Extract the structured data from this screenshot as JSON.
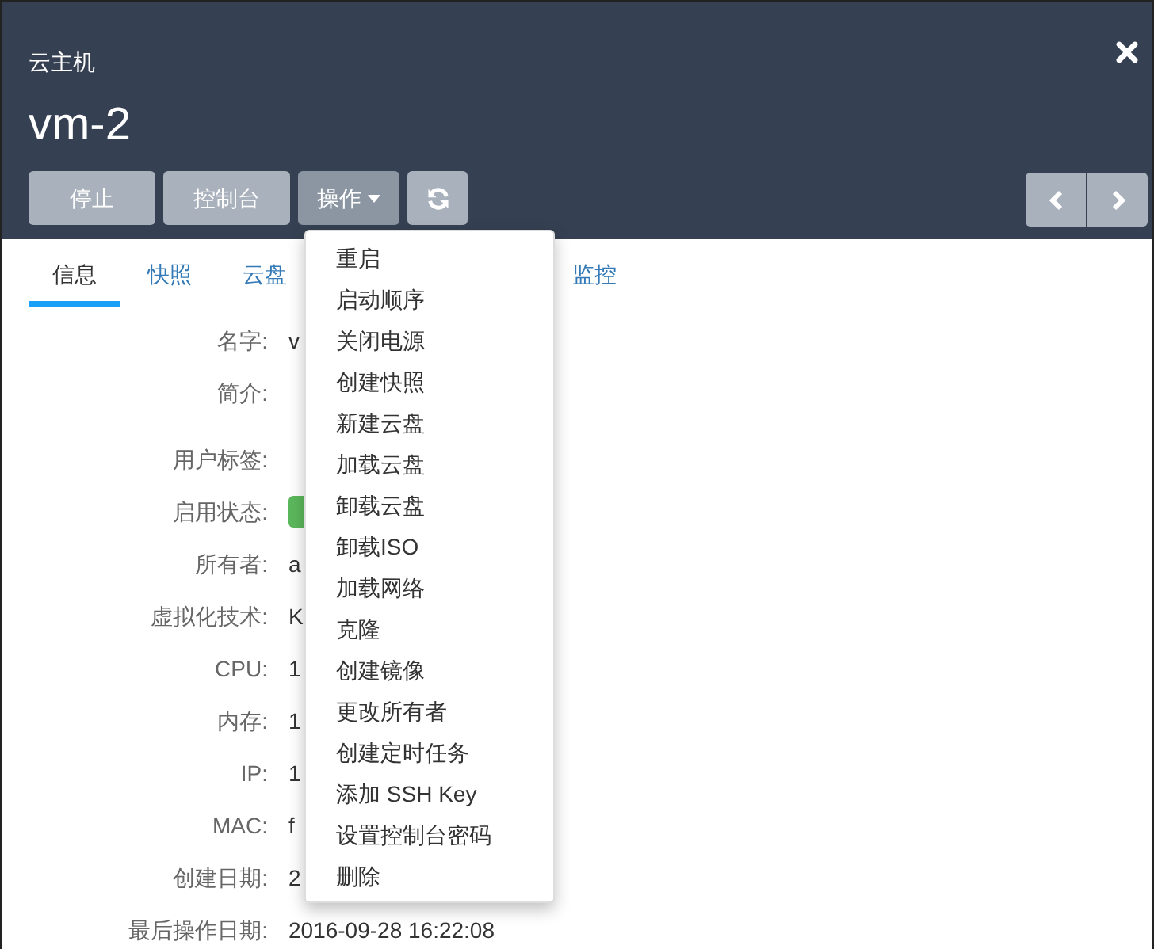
{
  "header": {
    "subtitle": "云主机",
    "title": "vm-2"
  },
  "toolbar": {
    "buttons": [
      {
        "label": "停止",
        "kind": "plain"
      },
      {
        "label": "控制台",
        "kind": "plain"
      },
      {
        "label": "操作",
        "kind": "dropdown",
        "expanded": true
      },
      {
        "kind": "refresh"
      }
    ]
  },
  "tabs": [
    {
      "label": "信息",
      "selected": true
    },
    {
      "label": "快照",
      "selected": false
    },
    {
      "label": "云盘",
      "selected": false
    },
    {
      "label": "监控",
      "selected": false
    }
  ],
  "dropdown": {
    "items": [
      "重启",
      "启动顺序",
      "关闭电源",
      "创建快照",
      "新建云盘",
      "加载云盘",
      "卸载云盘",
      "卸载ISO",
      "加载网络",
      "克隆",
      "创建镜像",
      "更改所有者",
      "创建定时任务",
      "添加 SSH Key",
      "设置控制台密码",
      "删除"
    ]
  },
  "details": [
    {
      "label": "名字:",
      "value": "v",
      "kind": "text"
    },
    {
      "label": "简介:",
      "kind": "tall"
    },
    {
      "label": "用户标签:",
      "kind": "text"
    },
    {
      "label": "启用状态:",
      "kind": "badge",
      "color": "#5cb85c"
    },
    {
      "label": "所有者:",
      "value": "a",
      "kind": "text"
    },
    {
      "label": "虚拟化技术:",
      "value": "K",
      "kind": "text"
    },
    {
      "label": "CPU:",
      "value": "1",
      "kind": "text"
    },
    {
      "label": "内存:",
      "value": "1",
      "kind": "text"
    },
    {
      "label": "IP:",
      "value": "1",
      "kind": "text"
    },
    {
      "label": "MAC:",
      "value": "f",
      "kind": "text"
    },
    {
      "label": "创建日期:",
      "value": "2",
      "kind": "text"
    },
    {
      "label": "最后操作日期:",
      "value": "2016-09-28 16:22:08",
      "kind": "text"
    }
  ]
}
